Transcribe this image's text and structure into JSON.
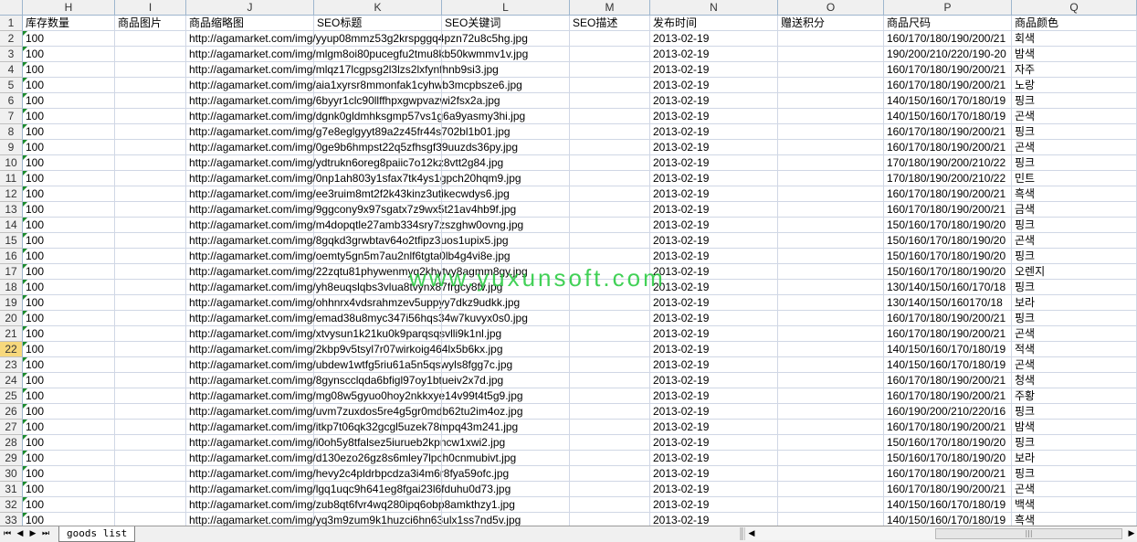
{
  "columns": [
    {
      "letter": "H",
      "header": "库存数量"
    },
    {
      "letter": "I",
      "header": "商品图片"
    },
    {
      "letter": "J",
      "header": "商品缩略图"
    },
    {
      "letter": "K",
      "header": "SEO标题"
    },
    {
      "letter": "L",
      "header": "SEO关键词"
    },
    {
      "letter": "M",
      "header": "SEO描述"
    },
    {
      "letter": "N",
      "header": "发布时间"
    },
    {
      "letter": "O",
      "header": "赠送积分"
    },
    {
      "letter": "P",
      "header": "商品尺码"
    },
    {
      "letter": "Q",
      "header": "商品颜色"
    }
  ],
  "header_row_number": "1",
  "rows": [
    {
      "n": "2",
      "qty": "100",
      "thumb": "http://agamarket.com/img/yyup08mmz53g2krspggq4pzn72u8c5hg.jpg",
      "date": "2013-02-19",
      "size": "160/170/180/190/200/21",
      "color": "회색"
    },
    {
      "n": "3",
      "qty": "100",
      "thumb": "http://agamarket.com/img/mlgm8oi80pucegfu2tmu8kb50kwmmv1v.jpg",
      "date": "2013-02-19",
      "size": "190/200/210/220/190-20",
      "color": "밤색"
    },
    {
      "n": "4",
      "qty": "100",
      "thumb": "http://agamarket.com/img/mlqz17lcgpsg2l3lzs2lxfynfhnb9si3.jpg",
      "date": "2013-02-19",
      "size": "160/170/180/190/200/21",
      "color": "자주"
    },
    {
      "n": "5",
      "qty": "100",
      "thumb": "http://agamarket.com/img/aia1xyrsr8mmonfak1cyhwb3mcpbsze6.jpg",
      "date": "2013-02-19",
      "size": "160/170/180/190/200/21",
      "color": "노랑"
    },
    {
      "n": "6",
      "qty": "100",
      "thumb": "http://agamarket.com/img/6byyr1clc90llffhpxgwpvazwi2fsx2a.jpg",
      "date": "2013-02-19",
      "size": "140/150/160/170/180/19",
      "color": "핑크"
    },
    {
      "n": "7",
      "qty": "100",
      "thumb": "http://agamarket.com/img/dgnk0gldmhksgmp57vs1g6a9yasmy3hi.jpg",
      "date": "2013-02-19",
      "size": "140/150/160/170/180/19",
      "color": "곤색"
    },
    {
      "n": "8",
      "qty": "100",
      "thumb": "http://agamarket.com/img/g7e8eglgyyt89a2z45fr44s702bl1b01.jpg",
      "date": "2013-02-19",
      "size": "160/170/180/190/200/21",
      "color": "핑크"
    },
    {
      "n": "9",
      "qty": "100",
      "thumb": "http://agamarket.com/img/0ge9b6hmpst22q5zfhsgf39uuzds36py.jpg",
      "date": "2013-02-19",
      "size": "160/170/180/190/200/21",
      "color": "곤색"
    },
    {
      "n": "10",
      "qty": "100",
      "thumb": "http://agamarket.com/img/ydtrukn6oreg8paiic7o12kz8vtt2g84.jpg",
      "date": "2013-02-19",
      "size": "170/180/190/200/210/22",
      "color": "핑크"
    },
    {
      "n": "11",
      "qty": "100",
      "thumb": "http://agamarket.com/img/0np1ah803y1sfax7tk4ys1gpch20hqm9.jpg",
      "date": "2013-02-19",
      "size": "170/180/190/200/210/22",
      "color": "민트"
    },
    {
      "n": "12",
      "qty": "100",
      "thumb": "http://agamarket.com/img/ee3ruim8mt2f2k43kinz3utikecwdys6.jpg",
      "date": "2013-02-19",
      "size": "160/170/180/190/200/21",
      "color": "흑색"
    },
    {
      "n": "13",
      "qty": "100",
      "thumb": "http://agamarket.com/img/9ggcony9x97sgatx7z9wx5t21av4hb9f.jpg",
      "date": "2013-02-19",
      "size": "160/170/180/190/200/21",
      "color": "금색"
    },
    {
      "n": "14",
      "qty": "100",
      "thumb": "http://agamarket.com/img/m4dopqtle27amb334sry7zszghw0ovng.jpg",
      "date": "2013-02-19",
      "size": "150/160/170/180/190/20",
      "color": "핑크"
    },
    {
      "n": "15",
      "qty": "100",
      "thumb": "http://agamarket.com/img/8gqkd3grwbtav64o2tfipz3uos1upix5.jpg",
      "date": "2013-02-19",
      "size": "150/160/170/180/190/20",
      "color": "곤색"
    },
    {
      "n": "16",
      "qty": "100",
      "thumb": "http://agamarket.com/img/oemty5gn5m7au2nlf6tgta0lb4g4vi8e.jpg",
      "date": "2013-02-19",
      "size": "150/160/170/180/190/20",
      "color": "핑크"
    },
    {
      "n": "17",
      "qty": "100",
      "thumb": "http://agamarket.com/img/22zqtu81phywenmyq2khytvy8agmm8gy.jpg",
      "date": "2013-02-19",
      "size": "150/160/170/180/190/20",
      "color": "오렌지"
    },
    {
      "n": "18",
      "qty": "100",
      "thumb": "http://agamarket.com/img/yh8euqslqbs3vlua8tvynx87frgcy8fv.jpg",
      "date": "2013-02-19",
      "size": "130/140/150/160/170/18",
      "color": "핑크"
    },
    {
      "n": "19",
      "qty": "100",
      "thumb": "http://agamarket.com/img/ohhnrx4vdsrahmzev5uppyy7dkz9udkk.jpg",
      "date": "2013-02-19",
      "size": "130/140/150/160170/18",
      "color": "보라"
    },
    {
      "n": "20",
      "qty": "100",
      "thumb": "http://agamarket.com/img/emad38u8myc347i56hqs34w7kuvyx0s0.jpg",
      "date": "2013-02-19",
      "size": "160/170/180/190/200/21",
      "color": "핑크"
    },
    {
      "n": "21",
      "qty": "100",
      "thumb": "http://agamarket.com/img/xtvysun1k21ku0k9parqsqsvlli9k1nl.jpg",
      "date": "2013-02-19",
      "size": "160/170/180/190/200/21",
      "color": "곤색"
    },
    {
      "n": "22",
      "qty": "100",
      "thumb": "http://agamarket.com/img/2kbp9v5tsyl7r07wirkoig464lx5b6kx.jpg",
      "date": "2013-02-19",
      "size": "140/150/160/170/180/19",
      "color": "적색"
    },
    {
      "n": "23",
      "qty": "100",
      "thumb": "http://agamarket.com/img/ubdew1wtfg5riu61a5n5qswyls8fgg7c.jpg",
      "date": "2013-02-19",
      "size": "140/150/160/170/180/19",
      "color": "곤색"
    },
    {
      "n": "24",
      "qty": "100",
      "thumb": "http://agamarket.com/img/8gynscclqda6bfigl97oy1btueiv2x7d.jpg",
      "date": "2013-02-19",
      "size": "160/170/180/190/200/21",
      "color": "청색"
    },
    {
      "n": "25",
      "qty": "100",
      "thumb": "http://agamarket.com/img/mg08w5gyuo0hoy2nkkxye14v99t4t5g9.jpg",
      "date": "2013-02-19",
      "size": "160/170/180/190/200/21",
      "color": "주황"
    },
    {
      "n": "26",
      "qty": "100",
      "thumb": "http://agamarket.com/img/uvm7zuxdos5re4g5gr0mdb62tu2im4oz.jpg",
      "date": "2013-02-19",
      "size": "160/190/200/210/220/16",
      "color": "핑크"
    },
    {
      "n": "27",
      "qty": "100",
      "thumb": "http://agamarket.com/img/itkp7t06qk32gcgl5uzek78mpq43m241.jpg",
      "date": "2013-02-19",
      "size": "160/170/180/190/200/21",
      "color": "밤색"
    },
    {
      "n": "28",
      "qty": "100",
      "thumb": "http://agamarket.com/img/i0oh5y8tfalsez5iurueb2kpncw1xwi2.jpg",
      "date": "2013-02-19",
      "size": "150/160/170/180/190/20",
      "color": "핑크"
    },
    {
      "n": "29",
      "qty": "100",
      "thumb": "http://agamarket.com/img/d130ezo26gz8s6mley7lpch0cnmubivt.jpg",
      "date": "2013-02-19",
      "size": "150/160/170/180/190/20",
      "color": "보라"
    },
    {
      "n": "30",
      "qty": "100",
      "thumb": "http://agamarket.com/img/hevy2c4pldrbpcdza3i4m6r8fya59ofc.jpg",
      "date": "2013-02-19",
      "size": "160/170/180/190/200/21",
      "color": "핑크"
    },
    {
      "n": "31",
      "qty": "100",
      "thumb": "http://agamarket.com/img/lgq1uqc9h641eg8fgai23l6fduhu0d73.jpg",
      "date": "2013-02-19",
      "size": "160/170/180/190/200/21",
      "color": "곤색"
    },
    {
      "n": "32",
      "qty": "100",
      "thumb": "http://agamarket.com/img/zub8qt6fvr4wq280ipq6obp8amkthzy1.jpg",
      "date": "2013-02-19",
      "size": "140/150/160/170/180/19",
      "color": "백색"
    },
    {
      "n": "33",
      "qty": "100",
      "thumb": "http://agamarket.com/img/yq3m9zum9k1huzci6hn63ulx1ss7nd5v.jpg",
      "date": "2013-02-19",
      "size": "140/150/160/170/180/19",
      "color": "흑색"
    }
  ],
  "selected_row": "22",
  "watermark": "www.yuxunsoft.com",
  "sheet_tab": "goods list",
  "nav_icons": [
    "first-sheet-icon",
    "prev-sheet-icon",
    "next-sheet-icon",
    "last-sheet-icon"
  ],
  "colors": {
    "header_bg": "#f0f0f0",
    "grid_line": "#d0d7e5",
    "selected_row_header": "#f7d87c",
    "watermark": "#22c93a"
  }
}
